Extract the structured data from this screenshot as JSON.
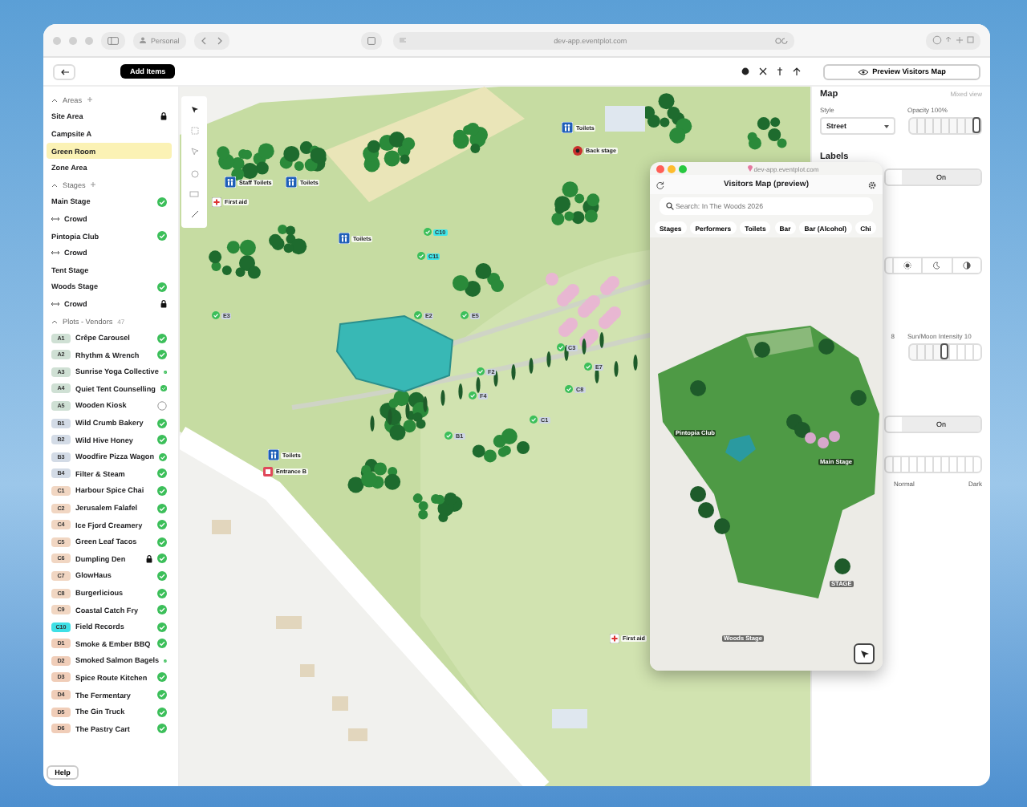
{
  "browser": {
    "profile": "Personal",
    "url": "dev-app.eventplot.com"
  },
  "toolbar": {
    "add_button": "Add Items",
    "preview_button": "Preview Visitors Map"
  },
  "sidebar": {
    "sections": [
      {
        "title": "Areas",
        "items": [
          {
            "kind": "item",
            "label": "Site Area",
            "locked": true,
            "selected": false
          },
          {
            "kind": "item",
            "label": "Campsite A",
            "locked": false,
            "selected": false
          },
          {
            "kind": "item",
            "label": "Green Room",
            "locked": false,
            "selected": true
          },
          {
            "kind": "item",
            "label": "Zone Area",
            "locked": false,
            "selected": false
          }
        ]
      },
      {
        "title": "Stages",
        "items": [
          {
            "kind": "item",
            "label": "Main Stage",
            "checked": true,
            "locked": false,
            "selected": false
          },
          {
            "kind": "crowd",
            "label": "Crowd",
            "locked": false,
            "selected": false
          },
          {
            "kind": "item",
            "label": "Pintopia Club",
            "checked": true,
            "locked": false,
            "selected": false
          },
          {
            "kind": "crowd",
            "label": "Crowd",
            "locked": false,
            "selected": false
          },
          {
            "kind": "item",
            "label": "Tent Stage",
            "locked": false,
            "selected": false
          },
          {
            "kind": "item",
            "label": "Woods Stage",
            "checked": true,
            "locked": false,
            "selected": false
          },
          {
            "kind": "crowd",
            "label": "Crowd",
            "locked": true,
            "selected": false
          }
        ]
      },
      {
        "title": "Plots - Vendors",
        "count": "47",
        "items": [
          {
            "kind": "plot",
            "code": "A1",
            "color": "#cfe0d4",
            "label": "Crêpe Carousel",
            "checked": true,
            "locked": false,
            "selected": false
          },
          {
            "kind": "plot",
            "code": "A2",
            "color": "#cfe0d4",
            "label": "Rhythm & Wrench",
            "checked": true,
            "locked": false,
            "selected": false
          },
          {
            "kind": "plot",
            "code": "A3",
            "color": "#cfe0d4",
            "label": "Sunrise Yoga Collective",
            "checked": true,
            "locked": false,
            "selected": false
          },
          {
            "kind": "plot",
            "code": "A4",
            "color": "#cfe0d4",
            "label": "Quiet Tent Counselling",
            "checked": true,
            "locked": false,
            "selected": false
          },
          {
            "kind": "plot",
            "code": "A5",
            "color": "#cfe0d4",
            "label": "Wooden Kiosk",
            "checked": false,
            "locked": false,
            "selected": false
          },
          {
            "kind": "plot",
            "code": "B1",
            "color": "#d3dbe6",
            "label": "Wild Crumb Bakery",
            "checked": true,
            "locked": false,
            "selected": false
          },
          {
            "kind": "plot",
            "code": "B2",
            "color": "#d3dbe6",
            "label": "Wild Hive Honey",
            "checked": true,
            "locked": false,
            "selected": false
          },
          {
            "kind": "plot",
            "code": "B3",
            "color": "#d3dbe6",
            "label": "Woodfire Pizza Wagon",
            "checked": true,
            "locked": false,
            "selected": false
          },
          {
            "kind": "plot",
            "code": "B4",
            "color": "#d3dbe6",
            "label": "Filter & Steam",
            "checked": true,
            "locked": false,
            "selected": false
          },
          {
            "kind": "plot",
            "code": "C1",
            "color": "#f1d6c2",
            "label": "Harbour Spice Chai",
            "checked": true,
            "locked": false,
            "selected": false
          },
          {
            "kind": "plot",
            "code": "C2",
            "color": "#f1d6c2",
            "label": "Jerusalem Falafel",
            "checked": true,
            "locked": false,
            "selected": false
          },
          {
            "kind": "plot",
            "code": "C4",
            "color": "#f1d6c2",
            "label": "Ice Fjord Creamery",
            "checked": true,
            "locked": false,
            "selected": false
          },
          {
            "kind": "plot",
            "code": "C5",
            "color": "#f1d6c2",
            "label": "Green Leaf Tacos",
            "checked": true,
            "locked": false,
            "selected": false
          },
          {
            "kind": "plot",
            "code": "C6",
            "color": "#f1d6c2",
            "label": "Dumpling Den",
            "checked": true,
            "locked": true,
            "selected": false
          },
          {
            "kind": "plot",
            "code": "C7",
            "color": "#f1d6c2",
            "label": "GlowHaus",
            "checked": true,
            "locked": false,
            "selected": false
          },
          {
            "kind": "plot",
            "code": "C8",
            "color": "#f1d6c2",
            "label": "Burgerlicious",
            "checked": true,
            "locked": false,
            "selected": false
          },
          {
            "kind": "plot",
            "code": "C9",
            "color": "#f1d6c2",
            "label": "Coastal Catch Fry",
            "checked": true,
            "locked": false,
            "selected": false
          },
          {
            "kind": "plot",
            "code": "C10",
            "color": "#3fe0e6",
            "label": "Field Records",
            "checked": true,
            "locked": false,
            "selected": false
          },
          {
            "kind": "plot",
            "code": "D1",
            "color": "#f0cdb8",
            "label": "Smoke & Ember BBQ",
            "checked": true,
            "locked": false,
            "selected": false
          },
          {
            "kind": "plot",
            "code": "D2",
            "color": "#f0cdb8",
            "label": "Smoked Salmon Bagels",
            "checked": true,
            "locked": false,
            "selected": false
          },
          {
            "kind": "plot",
            "code": "D3",
            "color": "#f0cdb8",
            "label": "Spice Route Kitchen",
            "checked": true,
            "locked": false,
            "selected": false
          },
          {
            "kind": "plot",
            "code": "D4",
            "color": "#f0cdb8",
            "label": "The Fermentary",
            "checked": true,
            "locked": false,
            "selected": false
          },
          {
            "kind": "plot",
            "code": "D5",
            "color": "#f0cdb8",
            "label": "The Gin Truck",
            "checked": true,
            "locked": false,
            "selected": false
          },
          {
            "kind": "plot",
            "code": "D6",
            "color": "#f0cdb8",
            "label": "The Pastry Cart",
            "checked": true,
            "locked": false,
            "selected": false
          }
        ]
      }
    ],
    "help_button": "Help"
  },
  "map": {
    "markers": [
      {
        "kind": "facility",
        "label": "Staff Toilets"
      },
      {
        "kind": "facility",
        "label": "Toilets"
      },
      {
        "kind": "aid",
        "label": "First aid"
      },
      {
        "kind": "facility",
        "label": "Toilets"
      },
      {
        "kind": "facility",
        "label": "Toilets"
      },
      {
        "kind": "stage",
        "label": "Back stage"
      },
      {
        "kind": "plot",
        "label": "C10"
      },
      {
        "kind": "plot",
        "label": "C11"
      },
      {
        "kind": "plot",
        "label": "E3"
      },
      {
        "kind": "plot",
        "label": "E2"
      },
      {
        "kind": "plot",
        "label": "E5"
      },
      {
        "kind": "plot",
        "label": "F2"
      },
      {
        "kind": "plot",
        "label": "F4"
      },
      {
        "kind": "plot",
        "label": "C3"
      },
      {
        "kind": "plot",
        "label": "E7"
      },
      {
        "kind": "plot",
        "label": "C8"
      },
      {
        "kind": "plot",
        "label": "C1"
      },
      {
        "kind": "plot",
        "label": "B1"
      },
      {
        "kind": "facility",
        "label": "Toilets"
      },
      {
        "kind": "gate",
        "label": "Entrance B"
      },
      {
        "kind": "aid",
        "label": "First aid"
      }
    ]
  },
  "map_panel": {
    "title": "Map",
    "mode": "Mixed view",
    "style_label": "Style",
    "style_value": "Street",
    "opacity_label": "Opacity 100%",
    "opacity": {
      "level": 1
    },
    "labels_title": "Labels",
    "labels_toggle": {
      "label": "On",
      "selected": true
    },
    "theme_options": [
      {
        "kind": "sun",
        "selected": false
      },
      {
        "kind": "moon",
        "selected": false
      },
      {
        "kind": "contrast",
        "selected": false
      }
    ],
    "left_value": "8",
    "intensity_label": "Sun/Moon Intensity 10",
    "intensity": {
      "level": 0.5
    },
    "second_toggle": {
      "label": "On",
      "selected": true
    },
    "scale_labels": [
      "Normal",
      "Dark"
    ]
  },
  "preview": {
    "url": "dev-app.eventplot.com",
    "title": "Visitors Map (preview)",
    "search": {
      "placeholder": "Search: In The Woods 2026"
    },
    "chips": [
      "Stages",
      "Performers",
      "Toilets",
      "Bar",
      "Bar (Alcohol)",
      "Chi"
    ],
    "labels": [
      "Pintopia Club",
      "Main Stage",
      "STAGE",
      "Woods Stage"
    ]
  }
}
